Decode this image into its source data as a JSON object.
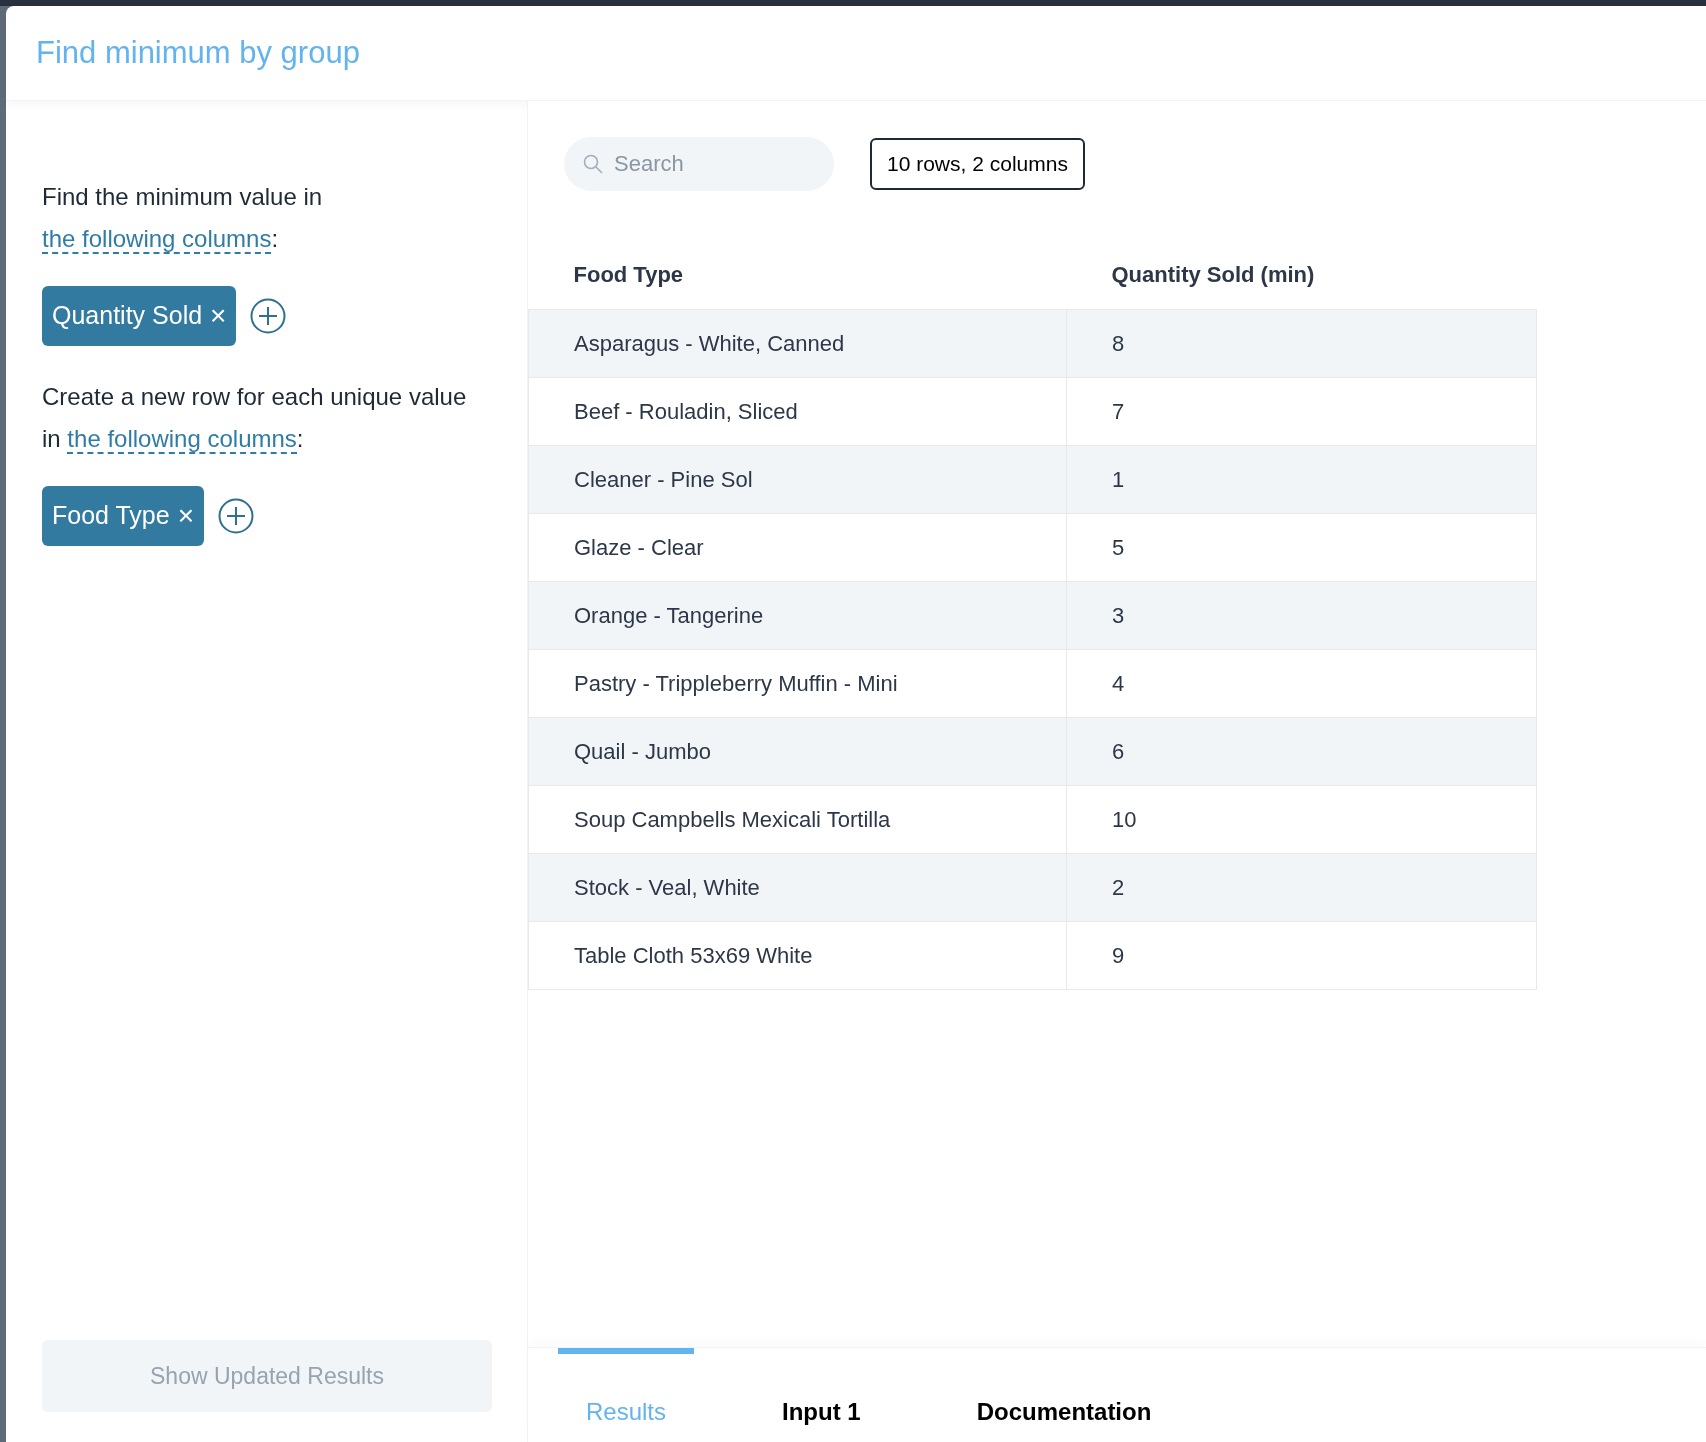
{
  "window": {
    "title": "Find minimum by group"
  },
  "sections": [
    {
      "text_before": "Find the minimum value in ",
      "link": "the following columns",
      "text_after": ":",
      "chips": [
        {
          "label": "Quantity Sold",
          "remove": "×"
        }
      ]
    },
    {
      "text_before": "Create a new row for each unique value in ",
      "link": "the following columns",
      "text_after": ":",
      "chips": [
        {
          "label": "Food Type",
          "remove": "×"
        }
      ]
    }
  ],
  "apply_button": {
    "label": "Show Updated Results",
    "disabled": true
  },
  "search": {
    "placeholder": "Search"
  },
  "summary": "10 rows, 2 columns",
  "table": {
    "columns": [
      "Food Type",
      "Quantity Sold (min)"
    ],
    "rows": [
      [
        "Asparagus - White, Canned",
        "8"
      ],
      [
        "Beef - Rouladin, Sliced",
        "7"
      ],
      [
        "Cleaner - Pine Sol",
        "1"
      ],
      [
        "Glaze - Clear",
        "5"
      ],
      [
        "Orange - Tangerine",
        "3"
      ],
      [
        "Pastry - Trippleberry Muffin - Mini",
        "4"
      ],
      [
        "Quail - Jumbo",
        "6"
      ],
      [
        "Soup Campbells Mexicali Tortilla",
        "10"
      ],
      [
        "Stock - Veal, White",
        "2"
      ],
      [
        "Table Cloth 53x69 White",
        "9"
      ]
    ]
  },
  "tabs": [
    {
      "label": "Results",
      "selected": true
    },
    {
      "label": "Input 1",
      "selected": false
    },
    {
      "label": "Documentation",
      "selected": false
    }
  ]
}
